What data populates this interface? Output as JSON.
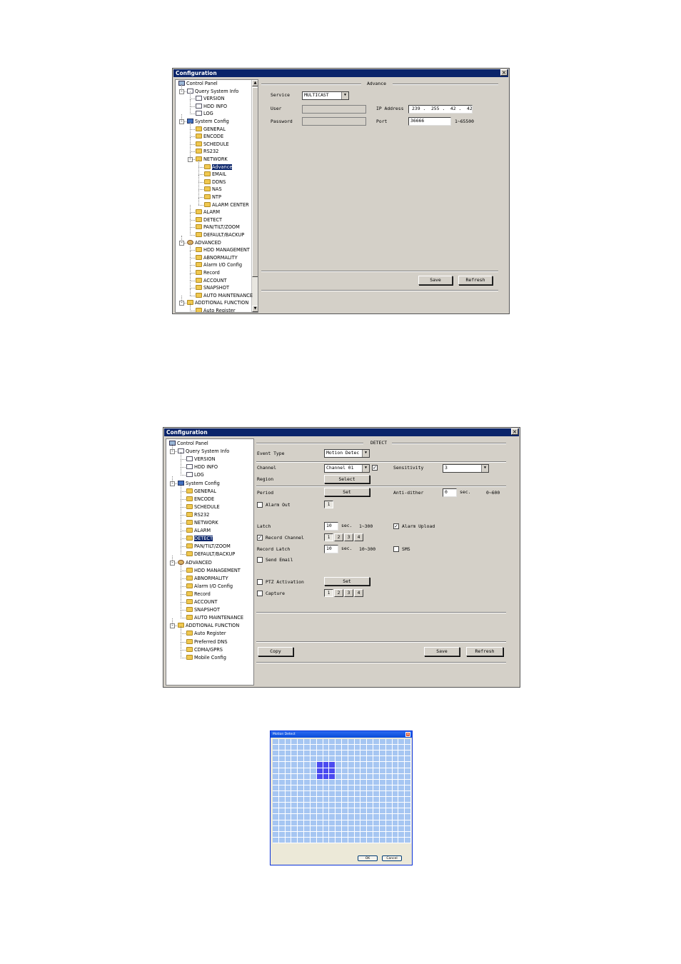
{
  "window1": {
    "title": "Configuration",
    "section_title": "Advance",
    "tree": [
      {
        "label": "Control Panel",
        "level": 0,
        "icon": "computer-icon"
      },
      {
        "label": "Query System Info",
        "level": 1,
        "icon": "query-icon"
      },
      {
        "label": "VERSION",
        "level": 2,
        "icon": "doc-icon"
      },
      {
        "label": "HDD INFO",
        "level": 2,
        "icon": "doc-icon"
      },
      {
        "label": "LOG",
        "level": 2,
        "icon": "doc-icon"
      },
      {
        "label": "System Config",
        "level": 1,
        "icon": "system-icon"
      },
      {
        "label": "GENERAL",
        "level": 2,
        "icon": "folder-icon"
      },
      {
        "label": "ENCODE",
        "level": 2,
        "icon": "folder-icon"
      },
      {
        "label": "SCHEDULE",
        "level": 2,
        "icon": "folder-icon"
      },
      {
        "label": "RS232",
        "level": 2,
        "icon": "folder-icon"
      },
      {
        "label": "NETWORK",
        "level": 2,
        "icon": "folder-icon"
      },
      {
        "label": "Advance",
        "level": 3,
        "icon": "folder-icon",
        "selected": true
      },
      {
        "label": "EMAIL",
        "level": 3,
        "icon": "folder-icon"
      },
      {
        "label": "DDNS",
        "level": 3,
        "icon": "folder-icon"
      },
      {
        "label": "NAS",
        "level": 3,
        "icon": "folder-icon"
      },
      {
        "label": "NTP",
        "level": 3,
        "icon": "folder-icon"
      },
      {
        "label": "ALARM CENTER",
        "level": 3,
        "icon": "folder-icon"
      },
      {
        "label": "ALARM",
        "level": 2,
        "icon": "folder-icon"
      },
      {
        "label": "DETECT",
        "level": 2,
        "icon": "folder-icon"
      },
      {
        "label": "PAN/TILT/ZOOM",
        "level": 2,
        "icon": "folder-icon"
      },
      {
        "label": "DEFAULT/BACKUP",
        "level": 2,
        "icon": "folder-icon"
      },
      {
        "label": "ADVANCED",
        "level": 1,
        "icon": "gear-icon"
      },
      {
        "label": "HDD MANAGEMENT",
        "level": 2,
        "icon": "folder-icon"
      },
      {
        "label": "ABNORMALITY",
        "level": 2,
        "icon": "folder-icon"
      },
      {
        "label": "Alarm I/O Config",
        "level": 2,
        "icon": "folder-icon"
      },
      {
        "label": "Record",
        "level": 2,
        "icon": "folder-icon"
      },
      {
        "label": "ACCOUNT",
        "level": 2,
        "icon": "folder-icon"
      },
      {
        "label": "SNAPSHOT",
        "level": 2,
        "icon": "folder-icon"
      },
      {
        "label": "AUTO MAINTENANCE",
        "level": 2,
        "icon": "folder-icon"
      },
      {
        "label": "ADDTIONAL FUNCTION",
        "level": 1,
        "icon": "folder-icon"
      },
      {
        "label": "Auto Register",
        "level": 2,
        "icon": "folder-icon"
      }
    ],
    "form": {
      "service_label": "Service",
      "service_value": "MULTICAST",
      "user_label": "User",
      "password_label": "Password",
      "ip_label": "IP Address",
      "ip": [
        "239",
        "255",
        "42",
        "42"
      ],
      "port_label": "Port",
      "port_value": "36666",
      "port_range": "1~65500"
    },
    "buttons": {
      "save": "Save",
      "refresh": "Refresh"
    }
  },
  "window2": {
    "title": "Configuration",
    "section_title": "DETECT",
    "tree": [
      {
        "label": "Control Panel",
        "level": 0,
        "icon": "computer-icon"
      },
      {
        "label": "Query System Info",
        "level": 1,
        "icon": "query-icon"
      },
      {
        "label": "VERSION",
        "level": 2,
        "icon": "doc-icon"
      },
      {
        "label": "HDD INFO",
        "level": 2,
        "icon": "doc-icon"
      },
      {
        "label": "LOG",
        "level": 2,
        "icon": "doc-icon"
      },
      {
        "label": "System Config",
        "level": 1,
        "icon": "system-icon"
      },
      {
        "label": "GENERAL",
        "level": 2,
        "icon": "folder-icon"
      },
      {
        "label": "ENCODE",
        "level": 2,
        "icon": "folder-icon"
      },
      {
        "label": "SCHEDULE",
        "level": 2,
        "icon": "folder-icon"
      },
      {
        "label": "RS232",
        "level": 2,
        "icon": "folder-icon"
      },
      {
        "label": "NETWORK",
        "level": 2,
        "icon": "folder-icon"
      },
      {
        "label": "ALARM",
        "level": 2,
        "icon": "folder-icon"
      },
      {
        "label": "DETECT",
        "level": 2,
        "icon": "folder-icon",
        "selected": true
      },
      {
        "label": "PAN/TILT/ZOOM",
        "level": 2,
        "icon": "folder-icon"
      },
      {
        "label": "DEFAULT/BACKUP",
        "level": 2,
        "icon": "folder-icon"
      },
      {
        "label": "ADVANCED",
        "level": 1,
        "icon": "gear-icon"
      },
      {
        "label": "HDD MANAGEMENT",
        "level": 2,
        "icon": "folder-icon"
      },
      {
        "label": "ABNORMALITY",
        "level": 2,
        "icon": "folder-icon"
      },
      {
        "label": "Alarm I/O Config",
        "level": 2,
        "icon": "folder-icon"
      },
      {
        "label": "Record",
        "level": 2,
        "icon": "folder-icon"
      },
      {
        "label": "ACCOUNT",
        "level": 2,
        "icon": "folder-icon"
      },
      {
        "label": "SNAPSHOT",
        "level": 2,
        "icon": "folder-icon"
      },
      {
        "label": "AUTO MAINTENANCE",
        "level": 2,
        "icon": "folder-icon"
      },
      {
        "label": "ADDTIONAL FUNCTION",
        "level": 1,
        "icon": "folder-icon"
      },
      {
        "label": "Auto Register",
        "level": 2,
        "icon": "folder-icon"
      },
      {
        "label": "Preferred DNS",
        "level": 2,
        "icon": "folder-icon"
      },
      {
        "label": "CDMA/GPRS",
        "level": 2,
        "icon": "folder-icon"
      },
      {
        "label": "Mobile Config",
        "level": 2,
        "icon": "folder-icon"
      }
    ],
    "form": {
      "event_type_label": "Event Type",
      "event_type_value": "Motion Detec",
      "channel_label": "Channel",
      "channel_value": "Channel 01",
      "sensitivity_label": "Sensitivity",
      "sensitivity_value": "3",
      "region_label": "Region",
      "select_btn": "Select",
      "period_label": "Period",
      "set_btn": "Set",
      "anti_dither_label": "Anti-dither",
      "anti_dither_value": "0",
      "anti_dither_unit": "sec.",
      "anti_dither_range": "0~600",
      "alarm_out_label": "Alarm Out",
      "alarm_out_channels": [
        "1"
      ],
      "latch_label": "Latch",
      "latch_value": "10",
      "latch_unit": "sec.",
      "latch_range": "1~300",
      "alarm_upload_label": "Alarm Upload",
      "record_channel_label": "Record Channel",
      "record_channels": [
        "1",
        "2",
        "3",
        "4"
      ],
      "record_latch_label": "Record Latch",
      "record_latch_value": "10",
      "record_latch_unit": "sec.",
      "record_latch_range": "10~300",
      "sms_label": "SMS",
      "send_email_label": "Send Email",
      "ptz_label": "PTZ Activation",
      "ptz_set_btn": "Set",
      "capture_label": "Capture",
      "capture_channels": [
        "1",
        "2",
        "3",
        "4"
      ]
    },
    "buttons": {
      "copy": "Copy",
      "save": "Save",
      "refresh": "Refresh"
    }
  },
  "motion_dialog": {
    "title": "Motion Detect",
    "ok": "OK",
    "cancel": "Cancel",
    "grid": {
      "cols": 22,
      "rows": 18,
      "selected_cells": [
        [
          7,
          4
        ],
        [
          8,
          4
        ],
        [
          9,
          4
        ],
        [
          7,
          5
        ],
        [
          8,
          5
        ],
        [
          9,
          5
        ],
        [
          7,
          6
        ],
        [
          8,
          6
        ],
        [
          9,
          6
        ]
      ]
    }
  }
}
